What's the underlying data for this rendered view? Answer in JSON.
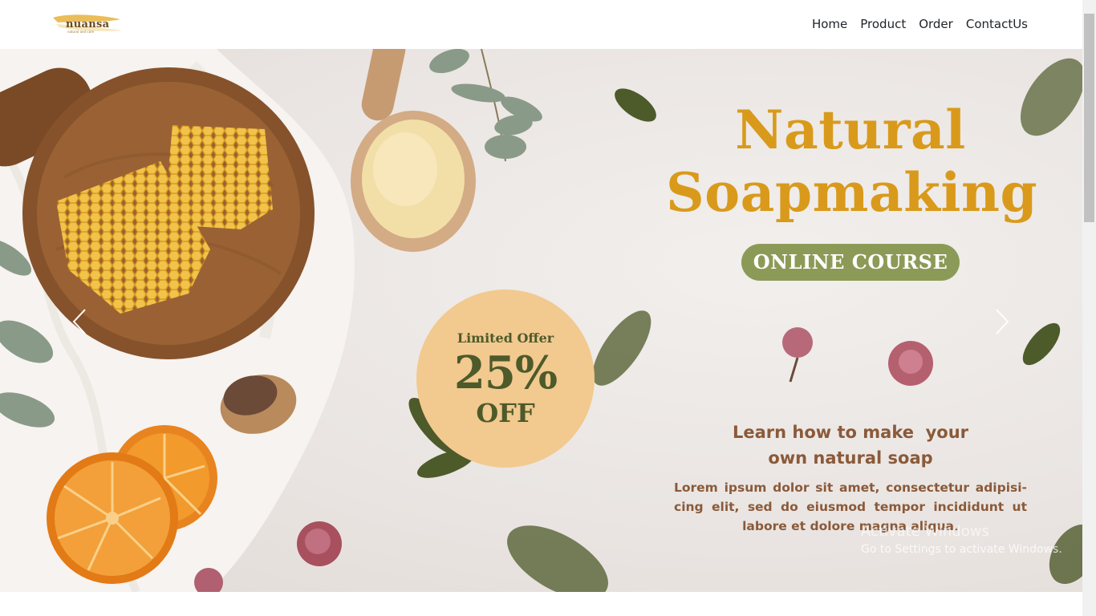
{
  "brand": {
    "name": "nuansa",
    "tagline": "natural and care"
  },
  "nav": {
    "items": [
      "Home",
      "Product",
      "Order",
      "ContactUs"
    ]
  },
  "hero": {
    "headline_line1": "Natural",
    "headline_line2": "Soapmaking",
    "badge": "ONLINE COURSE",
    "offer": {
      "label": "Limited Offer",
      "percent": "25%",
      "suffix": "OFF"
    },
    "sub_line1": "Learn how to make  your",
    "sub_line2": "own natural soap",
    "body": "Lorem ipsum dolor sit amet, consectetur adipisi-cing elit, sed do eiusmod tempor incididunt ut labore et dolore magna aliqua."
  },
  "watermark": {
    "line1": "Activate Windows",
    "line2": "Go to Settings to activate Windows."
  },
  "colors": {
    "headline": "#d99a1b",
    "badge": "#8c9a57",
    "offer_circle": "#f2c98f",
    "text_brown": "#8a5a3a",
    "leaf": "#4d5a2a"
  }
}
